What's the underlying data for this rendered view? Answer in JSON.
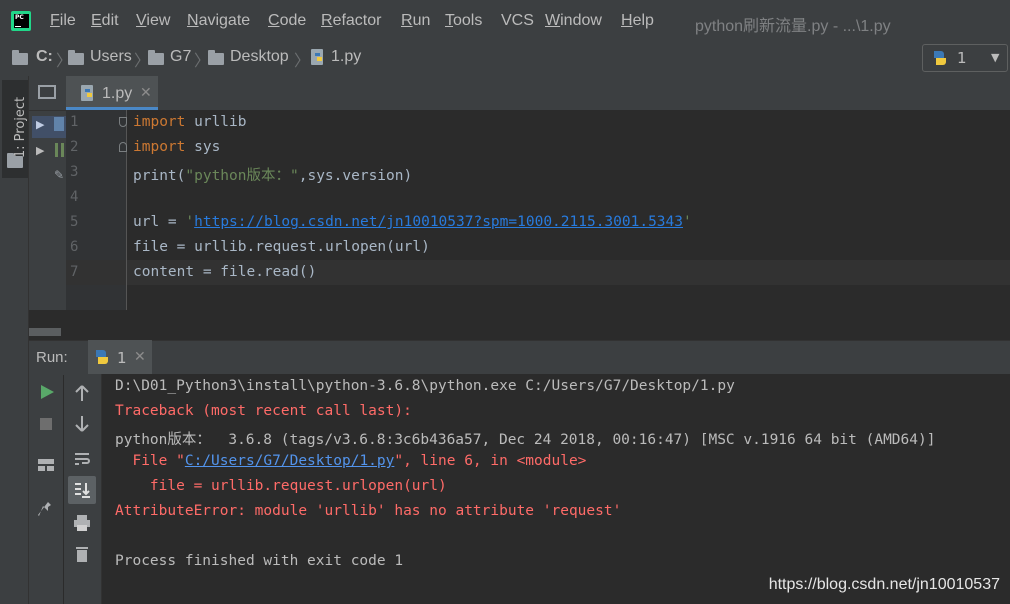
{
  "menu": {
    "items": [
      "File",
      "Edit",
      "View",
      "Navigate",
      "Code",
      "Refactor",
      "Run",
      "Tools",
      "VCS",
      "Window",
      "Help"
    ],
    "mnemonics": [
      "F",
      "E",
      "V",
      "N",
      "C",
      "R",
      "R",
      "T",
      "",
      "W",
      "H"
    ],
    "window_title": "python刷新流量.py - ...\\1.py"
  },
  "breadcrumb": {
    "items": [
      "C:",
      "Users",
      "G7",
      "Desktop",
      "1.py"
    ]
  },
  "run_config": {
    "label": "1"
  },
  "sidebar": {
    "project_tab": "1: Project"
  },
  "editor": {
    "tab_label": "1.py",
    "lines": [
      {
        "num": "1",
        "parts": [
          {
            "t": "import",
            "c": "kw"
          },
          {
            "t": " urllib",
            "c": ""
          }
        ]
      },
      {
        "num": "2",
        "parts": [
          {
            "t": "import",
            "c": "kw"
          },
          {
            "t": " sys",
            "c": ""
          }
        ]
      },
      {
        "num": "3",
        "parts": [
          {
            "t": "print(",
            "c": ""
          },
          {
            "t": "\"python版本：\"",
            "c": "str"
          },
          {
            "t": ",sys.version)",
            "c": ""
          }
        ]
      },
      {
        "num": "4",
        "parts": []
      },
      {
        "num": "5",
        "parts": [
          {
            "t": "url = ",
            "c": ""
          },
          {
            "t": "'",
            "c": "str"
          },
          {
            "t": "https://blog.csdn.net/jn10010537?spm=1000.2115.3001.5343",
            "c": "url"
          },
          {
            "t": "'",
            "c": "str"
          }
        ]
      },
      {
        "num": "6",
        "parts": [
          {
            "t": "file = urllib.request.urlopen(url)",
            "c": ""
          }
        ]
      },
      {
        "num": "7",
        "parts": [
          {
            "t": "content = file.read()",
            "c": ""
          }
        ]
      }
    ]
  },
  "run_panel": {
    "label": "Run:",
    "tab_label": "1",
    "console": [
      {
        "parts": [
          {
            "t": "D:\\D01_Python3\\install\\python-3.6.8\\python.exe C:/Users/G7/Desktop/1.py",
            "c": "con-white"
          }
        ]
      },
      {
        "parts": [
          {
            "t": "Traceback (most recent call last):",
            "c": "con-red"
          }
        ]
      },
      {
        "parts": [
          {
            "t": "python版本：  3.6.8 (tags/v3.6.8:3c6b436a57, Dec 24 2018, 00:16:47) [MSC v.1916 64 bit (AMD64)]",
            "c": "con-white"
          }
        ]
      },
      {
        "parts": [
          {
            "t": "  File \"",
            "c": "con-red"
          },
          {
            "t": "C:/Users/G7/Desktop/1.py",
            "c": "con-link"
          },
          {
            "t": "\", line 6, in <module>",
            "c": "con-red"
          }
        ]
      },
      {
        "parts": [
          {
            "t": "    file = urllib.request.urlopen(url)",
            "c": "con-red"
          }
        ]
      },
      {
        "parts": [
          {
            "t": "AttributeError: module 'urllib' has no attribute 'request'",
            "c": "con-red"
          }
        ]
      },
      {
        "parts": [
          {
            "t": "",
            "c": "con-white"
          }
        ]
      },
      {
        "parts": [
          {
            "t": "Process finished with exit code 1",
            "c": "con-white"
          }
        ]
      }
    ]
  },
  "watermark": "https://blog.csdn.net/jn10010537",
  "colors": {
    "background": "#2b2b2b",
    "keyword": "#cc7832",
    "string": "#6a8759",
    "error": "#ff6b68",
    "link": "#287bde"
  }
}
